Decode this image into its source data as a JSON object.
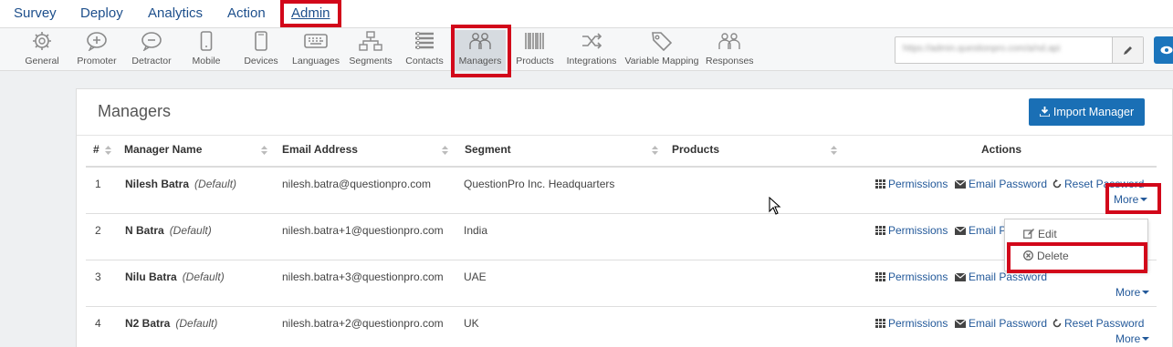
{
  "topnav": {
    "items": [
      {
        "label": "Survey"
      },
      {
        "label": "Deploy"
      },
      {
        "label": "Analytics"
      },
      {
        "label": "Action"
      },
      {
        "label": "Admin",
        "active": true
      }
    ]
  },
  "toolbar": {
    "tools": [
      {
        "label": "General",
        "icon": "gear-icon"
      },
      {
        "label": "Promoter",
        "icon": "promoter-icon"
      },
      {
        "label": "Detractor",
        "icon": "detractor-icon"
      },
      {
        "label": "Mobile",
        "icon": "mobile-icon"
      },
      {
        "label": "Devices",
        "icon": "devices-icon"
      },
      {
        "label": "Languages",
        "icon": "keyboard-icon"
      },
      {
        "label": "Segments",
        "icon": "segments-icon"
      },
      {
        "label": "Contacts",
        "icon": "contacts-icon"
      },
      {
        "label": "Managers",
        "icon": "managers-icon",
        "active": true
      },
      {
        "label": "Products",
        "icon": "barcode-icon"
      },
      {
        "label": "Integrations",
        "icon": "integrations-icon"
      },
      {
        "label": "Variable Mapping",
        "icon": "tag-icon"
      },
      {
        "label": "Responses",
        "icon": "responses-icon"
      }
    ],
    "url_value": "https://admin.questionpro.com/a/nd.api"
  },
  "panel": {
    "title": "Managers",
    "import_button": "Import Manager"
  },
  "table": {
    "headers": {
      "num": "#",
      "name": "Manager Name",
      "email": "Email Address",
      "segment": "Segment",
      "products": "Products",
      "actions": "Actions"
    },
    "rows": [
      {
        "num": "1",
        "name": "Nilesh Batra",
        "tag": "(Default)",
        "email": "nilesh.batra@questionpro.com",
        "segment": "QuestionPro Inc. Headquarters"
      },
      {
        "num": "2",
        "name": "N Batra",
        "tag": "(Default)",
        "email": "nilesh.batra+1@questionpro.com",
        "segment": "India"
      },
      {
        "num": "3",
        "name": "Nilu Batra",
        "tag": "(Default)",
        "email": "nilesh.batra+3@questionpro.com",
        "segment": "UAE"
      },
      {
        "num": "4",
        "name": "N2 Batra",
        "tag": "(Default)",
        "email": "nilesh.batra+2@questionpro.com",
        "segment": "UK"
      }
    ],
    "actions": {
      "permissions": "Permissions",
      "email_password": "Email Password",
      "reset_password": "Reset Password",
      "more": "More"
    }
  },
  "dropdown": {
    "edit": "Edit",
    "delete": "Delete"
  },
  "colors": {
    "link": "#23599a",
    "primary_button": "#1a6fb5",
    "highlight": "#d2071a"
  }
}
